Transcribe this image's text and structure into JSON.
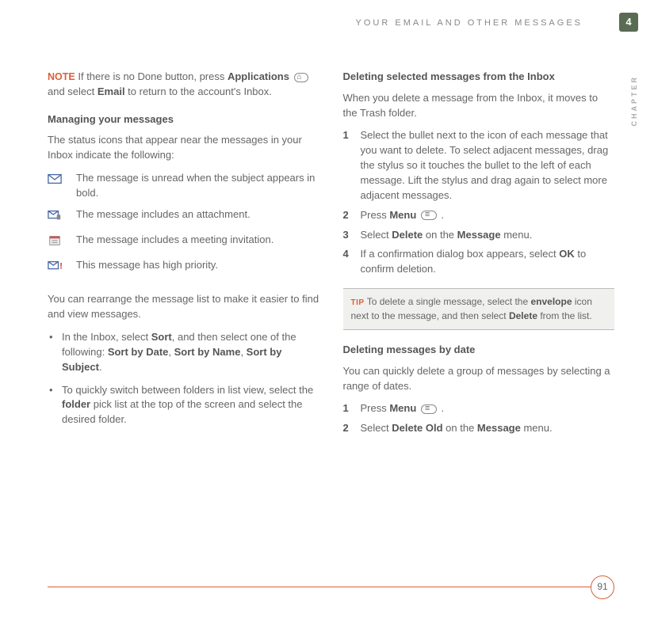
{
  "header": {
    "breadcrumb": "YOUR EMAIL AND OTHER MESSAGES"
  },
  "chapter": {
    "number": "4",
    "label": "CHAPTER"
  },
  "left": {
    "note_label": "NOTE",
    "note_text_1": "If there is no Done button, press ",
    "note_bold_1": "Applications",
    "note_text_2": " and select ",
    "note_bold_2": "Email",
    "note_text_3": " to return to the account's Inbox.",
    "managing_title": "Managing your messages",
    "managing_intro": "The status icons that appear near the messages in your Inbox indicate the following:",
    "icons": [
      {
        "name": "unread-icon",
        "desc": "The message is unread when the subject appears in bold."
      },
      {
        "name": "attachment-icon",
        "desc": "The message includes an attachment."
      },
      {
        "name": "meeting-icon",
        "desc": "The message includes a meeting invitation."
      },
      {
        "name": "priority-icon",
        "desc": "This message has high priority."
      }
    ],
    "rearrange_intro": "You can rearrange the message list to make it easier to find and view messages.",
    "bullets": [
      {
        "t1": "In the Inbox, select ",
        "b1": "Sort",
        "t2": ", and then select one of the following: ",
        "b2": "Sort by Date",
        "t3": ", ",
        "b3": "Sort by Name",
        "t4": ", ",
        "b4": "Sort by Subject",
        "t5": "."
      },
      {
        "t1": "To quickly switch between folders in list view, select the ",
        "b1": "folder",
        "t2": " pick list at the top of the screen and select the desired folder."
      }
    ]
  },
  "right": {
    "del_sel_title": "Deleting selected messages from the Inbox",
    "del_sel_intro": "When you delete a message from the Inbox, it moves to the Trash folder.",
    "steps1": [
      {
        "n": "1",
        "t": "Select the bullet next to the icon of each message that you want to delete. To select adjacent messages, drag the stylus so it touches the bullet to the left of each message. Lift the stylus and drag again to select more adjacent messages."
      },
      {
        "n": "2",
        "t1": "Press ",
        "b1": "Menu",
        "t2": " .",
        "menu": true
      },
      {
        "n": "3",
        "t1": "Select ",
        "b1": "Delete",
        "t2": " on the ",
        "b2": "Message",
        "t3": " menu."
      },
      {
        "n": "4",
        "t1": "If a confirmation dialog box appears, select ",
        "b1": "OK",
        "t2": " to confirm deletion."
      }
    ],
    "tip_label": "TIP",
    "tip_t1": "To delete a single message, select the ",
    "tip_b1": "envelope",
    "tip_t2": " icon next to the message, and then select ",
    "tip_b2": "Delete",
    "tip_t3": " from the list.",
    "del_date_title": "Deleting messages by date",
    "del_date_intro": "You can quickly delete a group of messages by selecting a range of dates.",
    "steps2": [
      {
        "n": "1",
        "t1": "Press ",
        "b1": "Menu",
        "t2": " .",
        "menu": true
      },
      {
        "n": "2",
        "t1": "Select ",
        "b1": "Delete Old",
        "t2": " on the ",
        "b2": "Message",
        "t3": " menu."
      }
    ]
  },
  "page_number": "91"
}
